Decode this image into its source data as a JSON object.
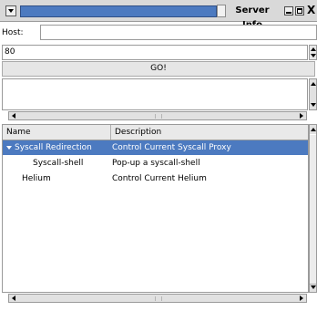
{
  "window": {
    "title": "Server Info",
    "close_glyph": "X",
    "icons": [
      "menu-icon",
      "minimize-icon",
      "maximize-icon",
      "close-icon"
    ]
  },
  "form": {
    "host_label": "Host:",
    "host_value": "",
    "port_value": "80",
    "go_label": "GO!"
  },
  "tree": {
    "columns": [
      "Name",
      "Description"
    ],
    "rows": [
      {
        "name": "Syscall Redirection",
        "description": "Control Current Syscall Proxy",
        "selected": true,
        "expanded": true,
        "level": 0
      },
      {
        "name": "Syscall-shell",
        "description": "Pop-up a syscall-shell",
        "selected": false,
        "level": 1
      },
      {
        "name": "Helium",
        "description": "Control Current Helium",
        "selected": false,
        "level": 0
      }
    ]
  },
  "colors": {
    "selection": "#4c7ac0",
    "title_strip": "#4c7ac0",
    "chrome": "#d9d9d9"
  }
}
